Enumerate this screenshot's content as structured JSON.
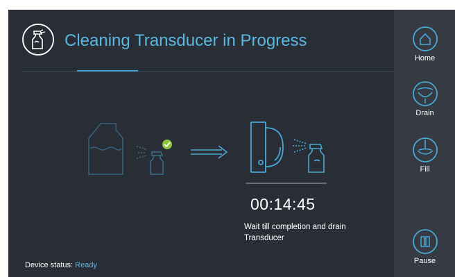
{
  "header": {
    "title": "Cleaning Transducer in Progress",
    "icon": "spray-bottle-icon"
  },
  "main": {
    "timer": "00:14:45",
    "message": "Wait till completion and drain Transducer",
    "status_label": "Device status: ",
    "status_value": "Ready"
  },
  "sidebar": {
    "items": [
      {
        "label": "Home",
        "icon": "home-icon"
      },
      {
        "label": "Drain",
        "icon": "drain-icon"
      },
      {
        "label": "Fill",
        "icon": "fill-icon"
      },
      {
        "label": "Pause",
        "icon": "pause-icon"
      }
    ]
  },
  "colors": {
    "background": "#292d35",
    "sidebar": "#353a43",
    "accent": "#5bb8e0",
    "success": "#8cc63f"
  }
}
